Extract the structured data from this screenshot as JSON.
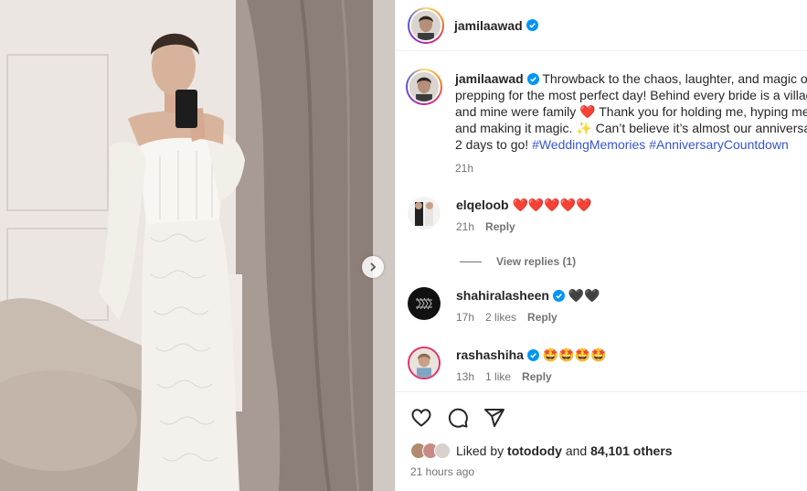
{
  "post": {
    "author": "jamilaawad",
    "caption_html_parts": {
      "line1": "Throwback to the chaos, laughter, and magic of",
      "line2": "prepping for the most perfect day! Behind every bride is a villag",
      "line3a": "and mine were family",
      "line3b": "Thank you for holding me, hyping me",
      "line4a": "and making it magic.",
      "line4b": "Can’t believe it’s almost our anniversa",
      "line5a": "2 days to go!",
      "hashtag1": "#WeddingMemories",
      "hashtag2": "#AnniversaryCountdown"
    },
    "caption_time": "21h"
  },
  "comments": [
    {
      "user": "elqeloob",
      "text": "❤️❤️❤️❤️❤️",
      "time": "21h",
      "likes": "",
      "reply": "Reply",
      "verified": false
    },
    {
      "user": "shahiralasheen",
      "text": "🖤🖤",
      "time": "17h",
      "likes": "2 likes",
      "reply": "Reply",
      "verified": true
    },
    {
      "user": "rashashiha",
      "text": "🤩🤩🤩🤩",
      "time": "13h",
      "likes": "1 like",
      "reply": "Reply",
      "verified": true
    }
  ],
  "view_replies": "View replies (1)",
  "likes": {
    "prefix": "Liked by",
    "user": "totodody",
    "mid": "and",
    "count": "84,101 others"
  },
  "timestamp": "21 hours ago",
  "icons": [
    "heart-icon",
    "comment-icon",
    "share-icon",
    "verified-badge-icon",
    "chevron-right-icon"
  ],
  "colors": {
    "accent": "#0095f6",
    "hashtag": "#3755d0",
    "meta": "#737373",
    "heart": "#ed4956"
  }
}
